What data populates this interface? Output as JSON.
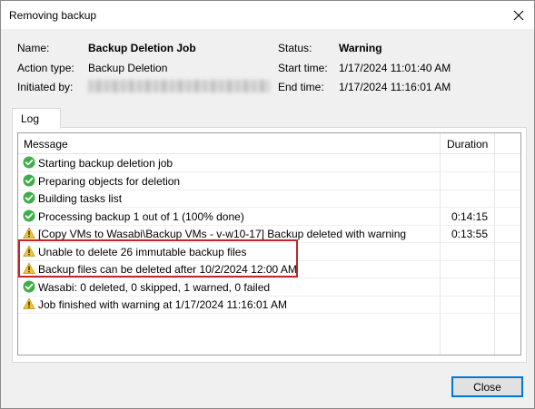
{
  "window": {
    "title": "Removing backup",
    "close_glyph": "✕"
  },
  "summary": {
    "name_label": "Name:",
    "name_value": "Backup Deletion Job",
    "action_type_label": "Action type:",
    "action_type_value": "Backup Deletion",
    "initiated_by_label": "Initiated by:",
    "status_label": "Status:",
    "status_value": "Warning",
    "start_time_label": "Start time:",
    "start_time_value": "1/17/2024 11:01:40 AM",
    "end_time_label": "End time:",
    "end_time_value": "1/17/2024 11:16:01 AM"
  },
  "tabs": [
    {
      "label": "Log"
    }
  ],
  "log": {
    "columns": {
      "message": "Message",
      "duration": "Duration"
    },
    "rows": [
      {
        "status": "success",
        "message": "Starting backup deletion job",
        "duration": ""
      },
      {
        "status": "success",
        "message": "Preparing objects for deletion",
        "duration": ""
      },
      {
        "status": "success",
        "message": "Building tasks list",
        "duration": ""
      },
      {
        "status": "success",
        "message": "Processing backup 1 out of 1 (100% done)",
        "duration": "0:14:15"
      },
      {
        "status": "warning",
        "message": "[Copy VMs to Wasabi\\Backup VMs - v-w10-17] Backup deleted with warning",
        "duration": "0:13:55"
      },
      {
        "status": "warning",
        "message": "Unable to delete 26 immutable backup files",
        "duration": ""
      },
      {
        "status": "warning",
        "message": "Backup files can be deleted after 10/2/2024 12:00 AM",
        "duration": ""
      },
      {
        "status": "success",
        "message": "Wasabi: 0 deleted, 0 skipped, 1 warned, 0 failed",
        "duration": ""
      },
      {
        "status": "warning",
        "message": "Job finished with warning at 1/17/2024 11:16:01 AM",
        "duration": ""
      }
    ]
  },
  "buttons": {
    "close_label": "Close"
  },
  "colors": {
    "success": "#3fae49",
    "warning": "#f2c12e",
    "highlight": "#c0262d",
    "accent": "#0078d7"
  },
  "icons": {
    "success": "check-circle-icon",
    "warning": "warning-triangle-icon"
  }
}
